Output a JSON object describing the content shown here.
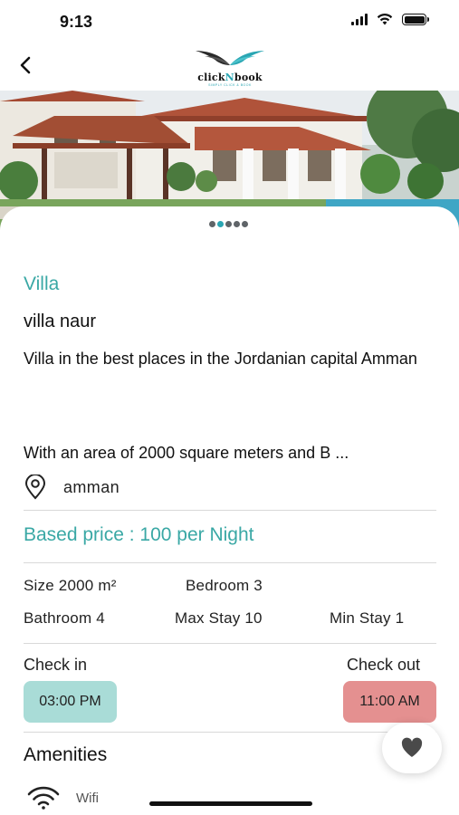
{
  "status": {
    "time": "9:13"
  },
  "nav": {
    "back_icon": "chevron-left-icon",
    "logo_text_a": "click",
    "logo_text_b": "N",
    "logo_text_c": "book",
    "logo_tagline": "SIMPLY CLICK & BOOK"
  },
  "gallery": {
    "page_count": 5,
    "active_index": 1
  },
  "listing": {
    "category": "Villa",
    "name": "villa naur",
    "description": "Villa in the best places in the Jordanian capital Amman",
    "description_more": "With an area of 2000 square meters and B ...",
    "location": "amman",
    "price": "Based price : 100 per Night"
  },
  "specs": {
    "size": "Size 2000 m²",
    "bedroom": "Bedroom 3",
    "bathroom": "Bathroom 4",
    "max_stay": "Max Stay 10",
    "min_stay": "Min Stay 1"
  },
  "checkin": {
    "label": "Check in",
    "time": "03:00 PM"
  },
  "checkout": {
    "label": "Check out",
    "time": "11:00 AM"
  },
  "amenities": {
    "title": "Amenities",
    "items": [
      {
        "icon": "wifi-icon",
        "label": "Wifi"
      }
    ]
  },
  "colors": {
    "accent": "#3aa8a5",
    "checkin_chip": "#a9dcd7",
    "checkout_chip": "#e49090"
  }
}
